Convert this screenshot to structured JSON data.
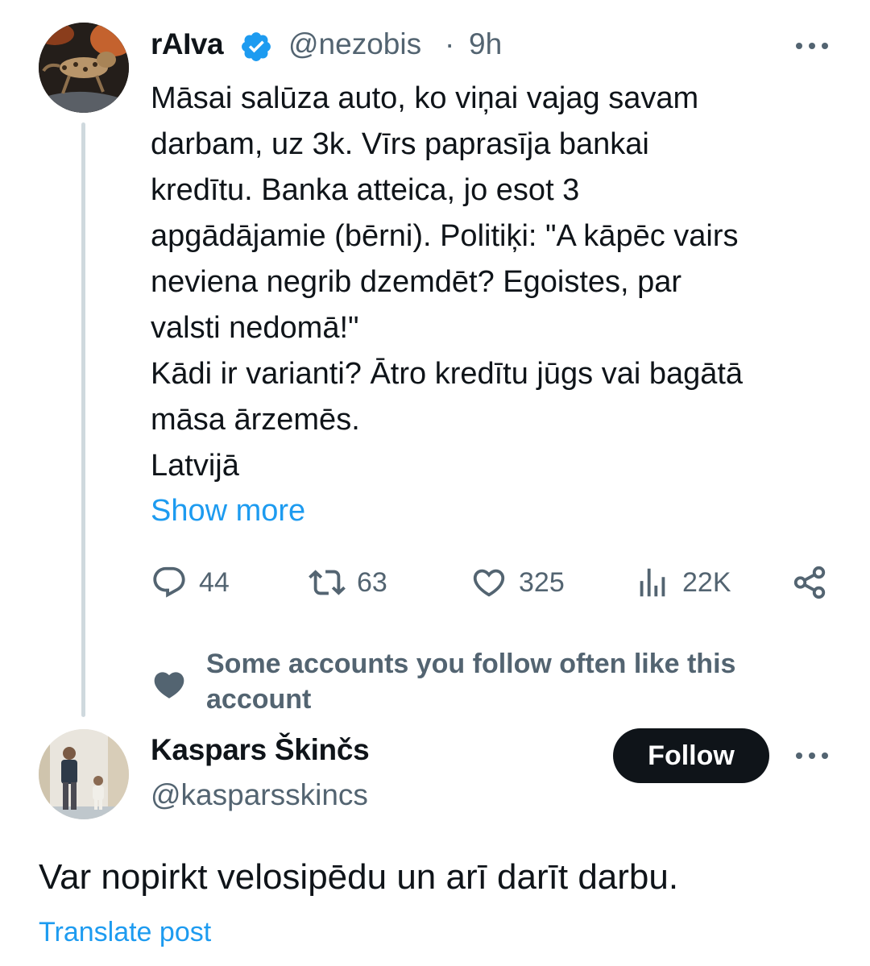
{
  "tweet": {
    "author_name": "rAIva",
    "handle": "@nezobis",
    "separator": "·",
    "time": "9h",
    "body_lines": [
      "Māsai salūza auto, ko viņai vajag savam",
      "darbam, uz 3k. Vīrs paprasīja bankai",
      "kredītu. Banka atteica, jo esot 3",
      "apgādājamie (bērni). Politiķi: \"A kāpēc vairs",
      "neviena negrib dzemdēt? Egoistes, par",
      "valsti nedomā!\"",
      "Kādi ir varianti? Ātro kredītu jūgs vai bagātā",
      "māsa ārzemēs.",
      "Latvijā"
    ],
    "show_more": "Show more",
    "stats": {
      "replies": "44",
      "reposts": "63",
      "likes": "325",
      "views": "22K"
    },
    "icons": [
      "more-icon",
      "verified-badge-icon",
      "reply-icon",
      "repost-icon",
      "like-icon",
      "views-icon",
      "share-icon"
    ]
  },
  "social_context": {
    "text": "Some accounts you follow often like this account",
    "icon": "heart-icon"
  },
  "reply": {
    "author_name": "Kaspars Škinčs",
    "handle": "@kasparsskincs",
    "follow_label": "Follow",
    "body": "Var nopirkt velosipēdu un arī darīt darbu.",
    "translate_label": "Translate post"
  },
  "colors": {
    "accent": "#1d9bf0",
    "text": "#0f1419",
    "secondary": "#536471",
    "thread_line": "#cfd9de"
  }
}
